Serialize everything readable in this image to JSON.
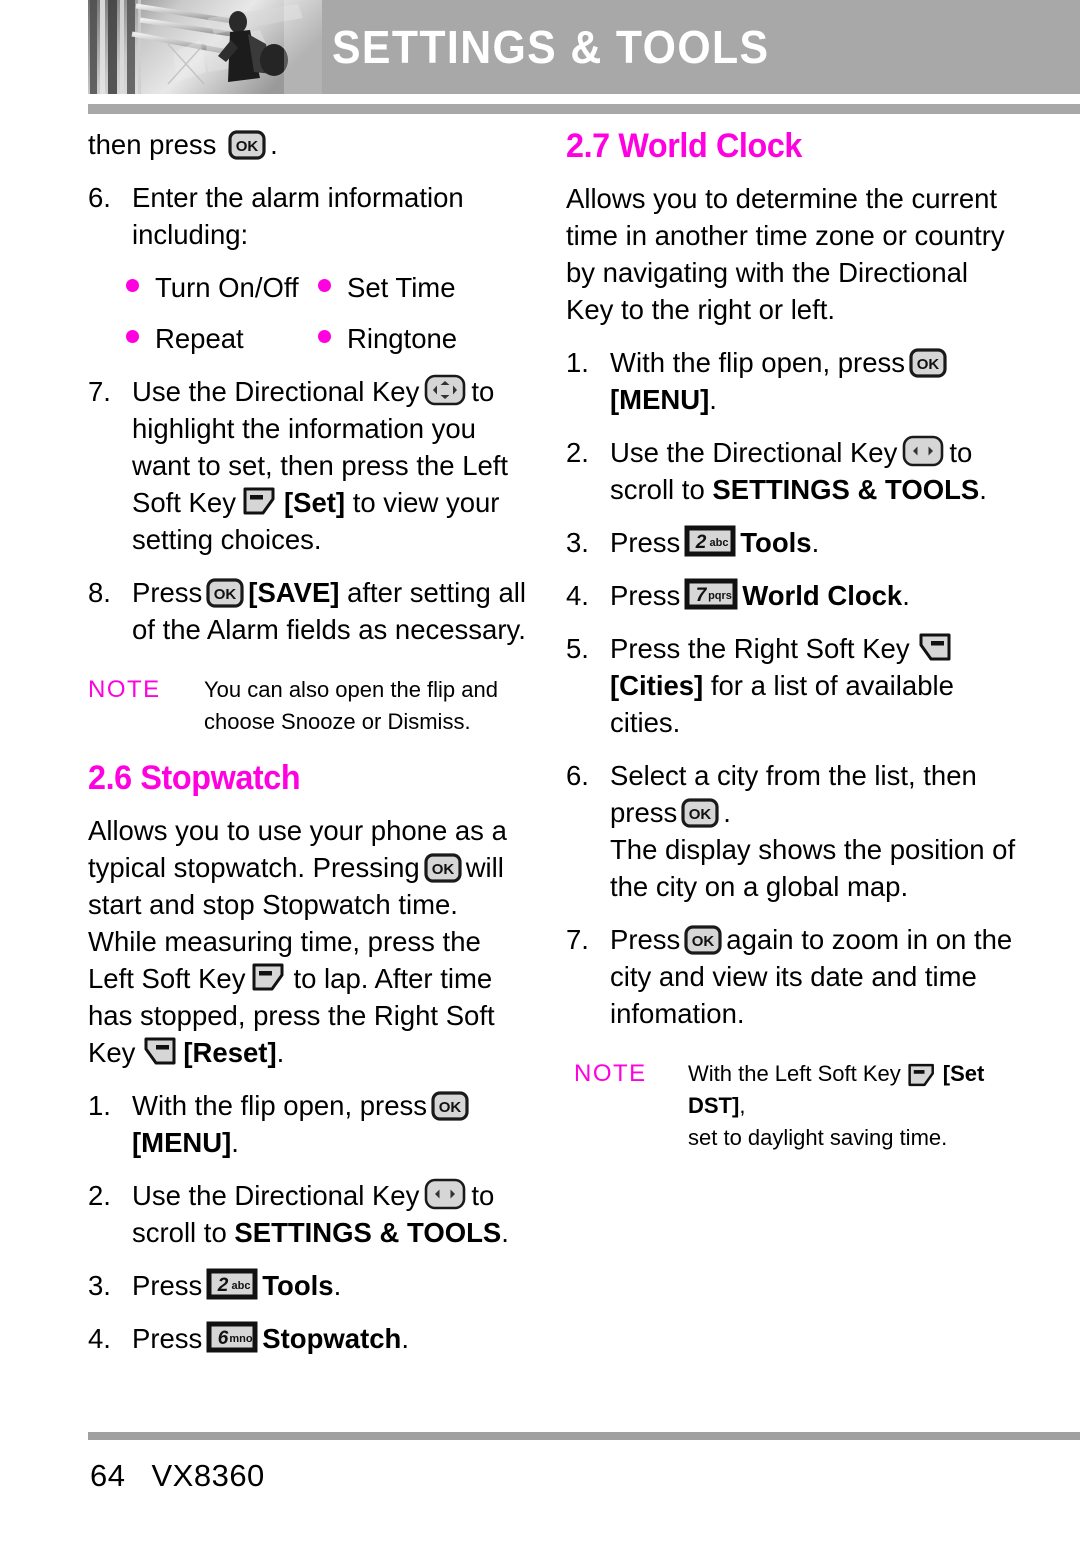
{
  "header": {
    "title": "SETTINGS & TOOLS",
    "photo_alt": "person-on-escalator-photo"
  },
  "footer": {
    "page_number": "64",
    "model": "VX8360"
  },
  "left_column": {
    "continued_step": {
      "text_before": "then press",
      "icon": "ok-key-icon",
      "text_after": "."
    },
    "step6": {
      "number": "6.",
      "text": "Enter the alarm information including:",
      "bullets": [
        [
          "Turn On/Off",
          "Set Time"
        ],
        [
          "Repeat",
          "Ringtone"
        ]
      ]
    },
    "step7": {
      "number": "7.",
      "part1": "Use the Directional Key",
      "icon1": "directional-key-4way-icon",
      "part2": "to highlight  the information you want to set, then press the Left Soft Key",
      "icon2": "left-soft-key-icon",
      "bracket": "[Set]",
      "part3": "to view your setting choices."
    },
    "step8": {
      "number": "8.",
      "part1": "Press",
      "icon1": "ok-key-icon",
      "bracket": "[SAVE]",
      "part2": "after setting all of the Alarm fields as necessary."
    },
    "note1": {
      "label": "NOTE",
      "text": "You can also open the flip and choose Snooze or Dismiss."
    },
    "section": {
      "heading": "2.6 Stopwatch",
      "intro": {
        "p1": "Allows you to use your phone as a typical stopwatch. Pressing",
        "icon1": "ok-key-icon",
        "p2": "will start and stop Stopwatch time. While measuring time, press the Left Soft Key",
        "icon2": "left-soft-key-icon",
        "p3": "to lap. After time has stopped, press the Right Soft Key",
        "icon3": "right-soft-key-icon",
        "bracket": "[Reset]",
        "p4": "."
      },
      "steps": [
        {
          "number": "1.",
          "part1": "With the flip open, press",
          "icon": "ok-key-icon",
          "bold": "[MENU]",
          "part2": "."
        },
        {
          "number": "2.",
          "part1": "Use the Directional Key",
          "icon": "directional-key-leftright-icon",
          "part2": "to scroll to",
          "bold": "SETTINGS & TOOLS",
          "part3": "."
        },
        {
          "number": "3.",
          "part1": "Press",
          "icon": "key-2-abc-icon",
          "bold": "Tools",
          "part2": "."
        },
        {
          "number": "4.",
          "part1": "Press",
          "icon": "key-6-mno-icon",
          "bold": "Stopwatch",
          "part2": "."
        }
      ]
    }
  },
  "right_column": {
    "section": {
      "heading": "2.7 World Clock",
      "intro": "Allows you to determine the current time in another time zone or country by navigating with the Directional Key to the right or left.",
      "steps": [
        {
          "number": "1.",
          "part1": "With the flip open, press",
          "icon": "ok-key-icon",
          "bold": "[MENU]",
          "part2": "."
        },
        {
          "number": "2.",
          "part1": "Use the Directional Key",
          "icon": "directional-key-leftright-icon",
          "part2": "to scroll to",
          "bold": "SETTINGS & TOOLS",
          "part3": "."
        },
        {
          "number": "3.",
          "part1": "Press",
          "icon": "key-2-abc-icon",
          "bold": "Tools",
          "part2": "."
        },
        {
          "number": "4.",
          "part1": "Press",
          "icon": "key-7-pqrs-icon",
          "bold": "World Clock",
          "part2": "."
        },
        {
          "number": "5.",
          "part1": "Press the Right Soft Key",
          "icon": "right-soft-key-icon",
          "bold": "[Cities]",
          "part2": "for a list of available cities."
        },
        {
          "number": "6.",
          "part1": "Select a city from the list, then press",
          "icon": "ok-key-icon",
          "part2": ".",
          "extra": "The display shows the position of the city on a global map."
        },
        {
          "number": "7.",
          "part1": "Press",
          "icon": "ok-key-icon",
          "part2": "again to zoom in on the city and view its date and time infomation."
        }
      ]
    },
    "note1": {
      "label": "NOTE",
      "part1": "With the Left Soft Key",
      "icon": "left-soft-key-icon",
      "bold": "[Set DST]",
      "part2": ",",
      "part3": "set to daylight saving time."
    }
  },
  "colors": {
    "accent_magenta": "#ff00e0",
    "header_gray": "#a8a8a8",
    "key_fill": "#d6d6d6",
    "text_black": "#000000"
  }
}
